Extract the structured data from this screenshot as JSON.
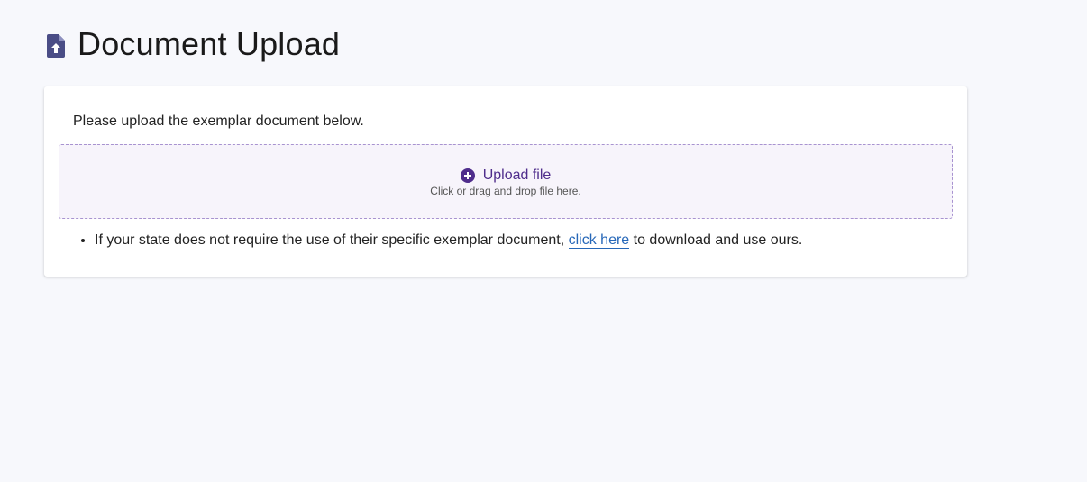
{
  "header": {
    "title": "Document Upload",
    "icon": "file-upload-icon",
    "icon_color": "#4a4d86"
  },
  "card": {
    "instructions": "Please upload the exemplar document below.",
    "dropzone": {
      "icon": "plus-circle-icon",
      "label": "Upload file",
      "hint": "Click or drag and drop file here.",
      "accent": "#4f2d8c"
    },
    "note": {
      "text_before": "If your state does not require the use of their specific exemplar document, ",
      "link": "click here",
      "text_after": " to download and use ours."
    }
  }
}
